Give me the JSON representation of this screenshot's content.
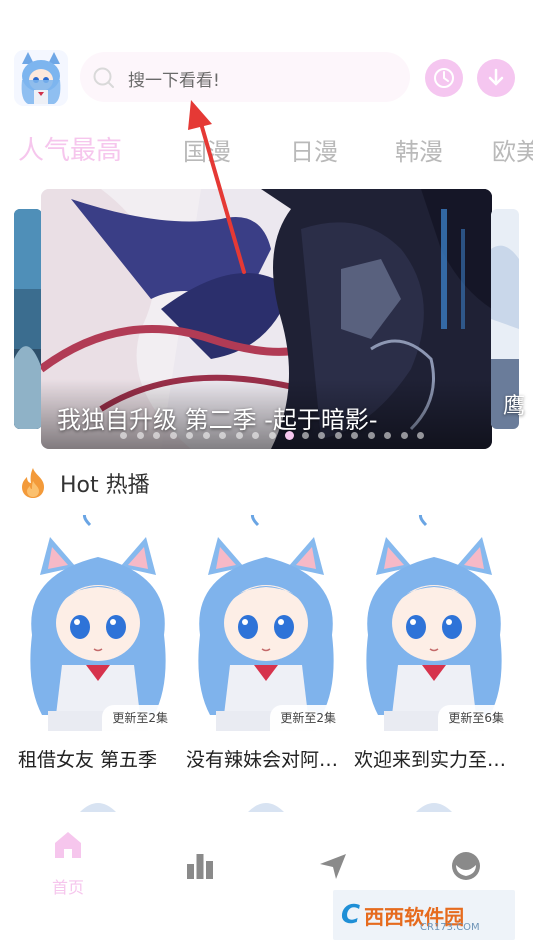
{
  "header": {
    "avatar_icon": "anime-cat-girl-avatar",
    "search_placeholder": "搜一下看看!",
    "history_icon": "clock-icon",
    "download_icon": "download-icon"
  },
  "tabs": [
    {
      "label": "人气最高",
      "active": true
    },
    {
      "label": "国漫",
      "active": false
    },
    {
      "label": "日漫",
      "active": false
    },
    {
      "label": "韩漫",
      "active": false
    },
    {
      "label": "欧美",
      "active": false
    }
  ],
  "banner": {
    "title": "我独自升级 第二季 -起于暗影-",
    "right_peek_text": "鹰",
    "dot_count": 19,
    "active_dot": 10
  },
  "hot_section": {
    "title": "Hot 热播",
    "items": [
      {
        "title": "租借女友 第五季",
        "badge": "更新至2集"
      },
      {
        "title": "没有辣妹会对阿宅温柔",
        "badge": "更新至2集"
      },
      {
        "title": "欢迎来到实力至上主义教室",
        "badge": "更新至6集"
      }
    ]
  },
  "bottom_nav": {
    "items": [
      {
        "label": "首页",
        "icon": "home-icon",
        "active": true
      },
      {
        "label": "",
        "icon": "bar-chart-icon",
        "active": false
      },
      {
        "label": "",
        "icon": "send-icon",
        "active": false
      },
      {
        "label": "",
        "icon": "profile-icon",
        "active": false
      }
    ]
  },
  "watermark": {
    "brand": "西西软件园",
    "logo_letter": "C",
    "url": "CR173.COM"
  },
  "colors": {
    "accent_pink": "#f6c6ed",
    "button_pink": "#f5c6f0",
    "flame_orange": "#f39a3a",
    "arrow_red": "#e53935"
  }
}
